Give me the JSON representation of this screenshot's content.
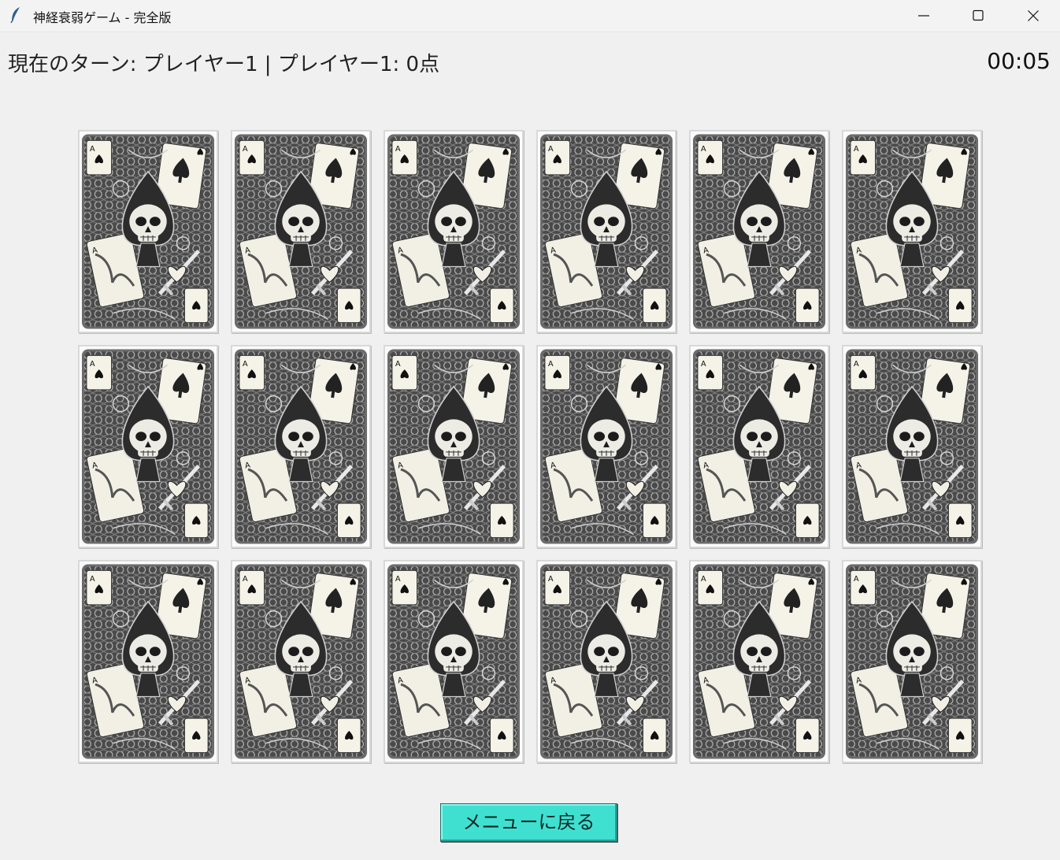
{
  "window": {
    "title": "神経衰弱ゲーム - 完全版",
    "icon": "feather-icon",
    "controls": [
      "minimize-icon",
      "maximize-icon",
      "close-icon"
    ]
  },
  "status": {
    "turn_text": "現在のターン: プレイヤー1 | プレイヤー1: 0点",
    "timer": "00:05"
  },
  "board": {
    "rows": 3,
    "columns": 6,
    "card_count": 18,
    "card_face": "skull-spade-card-back"
  },
  "menu_button": {
    "label": "メニューに戻る"
  },
  "colors": {
    "background": "#f0f0f0",
    "menu_button": "#40e0d0",
    "card_back_dark": "#3a3a3a"
  }
}
